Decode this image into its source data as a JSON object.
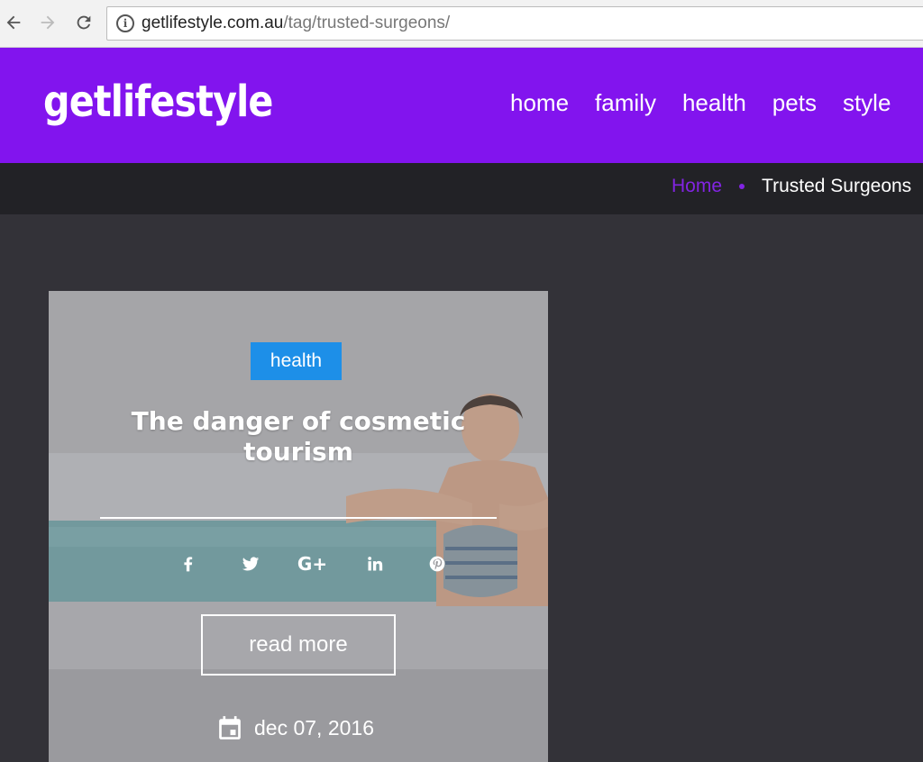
{
  "browser": {
    "url_host": "getlifestyle.com.au",
    "url_path": "/tag/trusted-surgeons/"
  },
  "site": {
    "logo": "getlifestyle",
    "nav": [
      {
        "label": "home"
      },
      {
        "label": "family"
      },
      {
        "label": "health"
      },
      {
        "label": "pets"
      },
      {
        "label": "style"
      }
    ],
    "header_color": "#8214ee"
  },
  "breadcrumb": {
    "home": "Home",
    "current": "Trusted Surgeons"
  },
  "card": {
    "category": "health",
    "title": "The danger of cosmetic tourism",
    "social_icons": [
      "facebook-icon",
      "twitter-icon",
      "google-plus-icon",
      "linkedin-icon",
      "pinterest-icon"
    ],
    "google_plus_glyph": "G+",
    "read_more": "read more",
    "date": "dec 07, 2016",
    "badge_color": "#1d8fe8"
  }
}
